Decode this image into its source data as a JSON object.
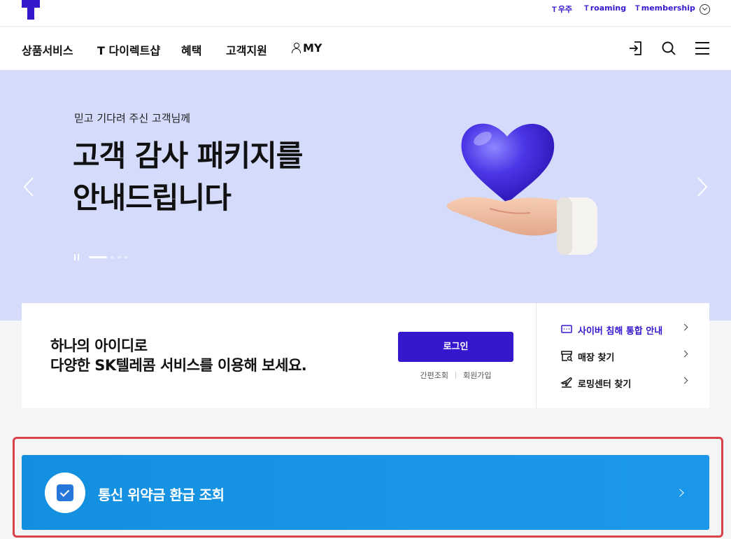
{
  "utility": {
    "t_universe": "우주",
    "t_roaming": "roaming",
    "t_membership": "membership",
    "t_mark": "T"
  },
  "gnb": {
    "items": [
      "상품서비스",
      "T 다이렉트샵",
      "혜택",
      "고객지원",
      "MY"
    ],
    "icons": [
      "login-icon",
      "search-icon",
      "menu-icon"
    ]
  },
  "hero": {
    "subtitle": "믿고 기다려 주신 고객님께",
    "title_line1": "고객 감사 패키지를",
    "title_line2": "안내드립니다",
    "slide_count": 4,
    "active_slide": 1,
    "bg_color": "#d4dbfb"
  },
  "login_card": {
    "text_line1": "하나의 아이디로",
    "text_line2": "다양한 SK텔레콤 서비스를 이용해 보세요.",
    "login_button": "로그인",
    "link_quick_lookup": "간편조회",
    "link_signup": "회원가입",
    "quick_links": [
      {
        "label": "사이버 침해 통합 안내",
        "icon": "notice-icon",
        "color": "#3617ce"
      },
      {
        "label": "매장 찾기",
        "icon": "store-icon",
        "color": "#111111"
      },
      {
        "label": "로밍센터 찾기",
        "icon": "airplane-icon",
        "color": "#111111"
      }
    ]
  },
  "banner": {
    "title": "통신 위약금 환급 조회",
    "icon": "check-icon",
    "color": "#1a96e8"
  },
  "colors": {
    "brand": "#3617ce",
    "highlight_border": "#d94247"
  }
}
